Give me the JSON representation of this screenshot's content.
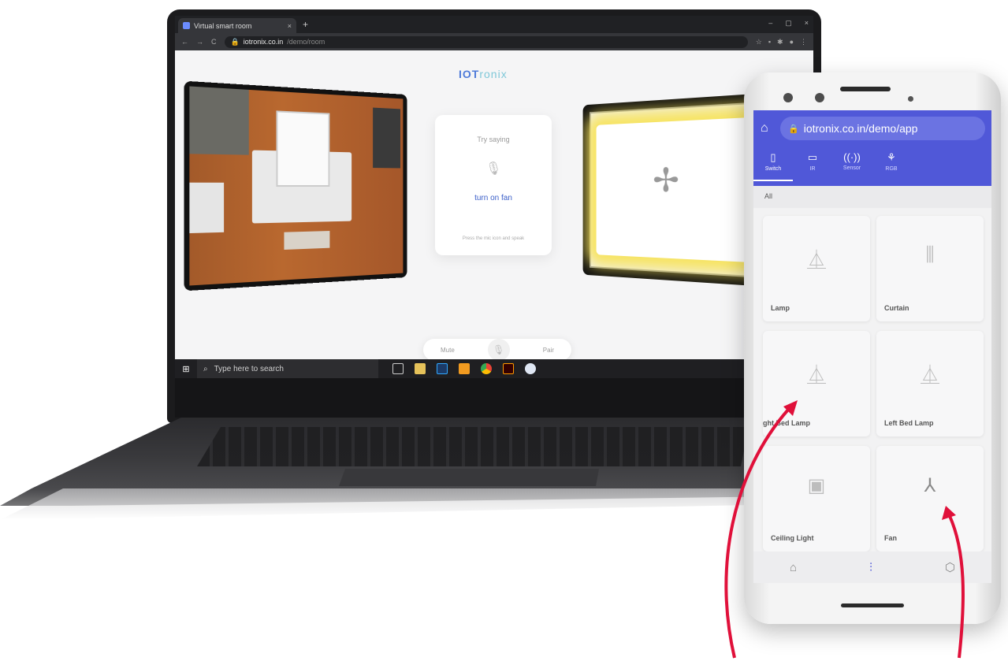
{
  "browser": {
    "tab_title": "Virtual smart room",
    "tab_close": "×",
    "new_tab": "+",
    "window_controls": [
      "–",
      "▢",
      "×"
    ],
    "url_host": "iotronix.co.in",
    "url_path": "/demo/room"
  },
  "page": {
    "brand_main": "IOT",
    "brand_accent": "ronix",
    "voice_card": {
      "prompt": "Try saying",
      "command": "turn on fan",
      "hint": "Press the mic icon and speak"
    },
    "controls": {
      "mute_label": "Mute",
      "pair_label": "Pair"
    }
  },
  "taskbar": {
    "search_placeholder": "Type here to search",
    "tray": "^ 🔊"
  },
  "phone": {
    "url": "iotronix.co.in/demo/app",
    "nav_tabs": [
      {
        "label": "Switch",
        "icon": "switch-icon"
      },
      {
        "label": "IR",
        "icon": "tv-icon"
      },
      {
        "label": "Sensor",
        "icon": "sensor-icon"
      },
      {
        "label": "RGB",
        "icon": "rgb-icon"
      }
    ],
    "filter": "All",
    "devices": [
      {
        "label": "Lamp",
        "icon": "lamp-icon"
      },
      {
        "label": "Curtain",
        "icon": "curtain-icon"
      },
      {
        "label": "ght Bed Lamp",
        "icon": "lamp-icon"
      },
      {
        "label": "Left Bed Lamp",
        "icon": "lamp-icon"
      },
      {
        "label": "Ceiling Light",
        "icon": "ceiling-light-icon"
      },
      {
        "label": "Fan",
        "icon": "fan-icon"
      }
    ],
    "bottom_nav": [
      "home-icon",
      "sliders-icon",
      "settings-icon"
    ]
  },
  "colors": {
    "accent": "#5058d8",
    "arrow": "#e0103a",
    "voice_command": "#3b5fc9"
  }
}
